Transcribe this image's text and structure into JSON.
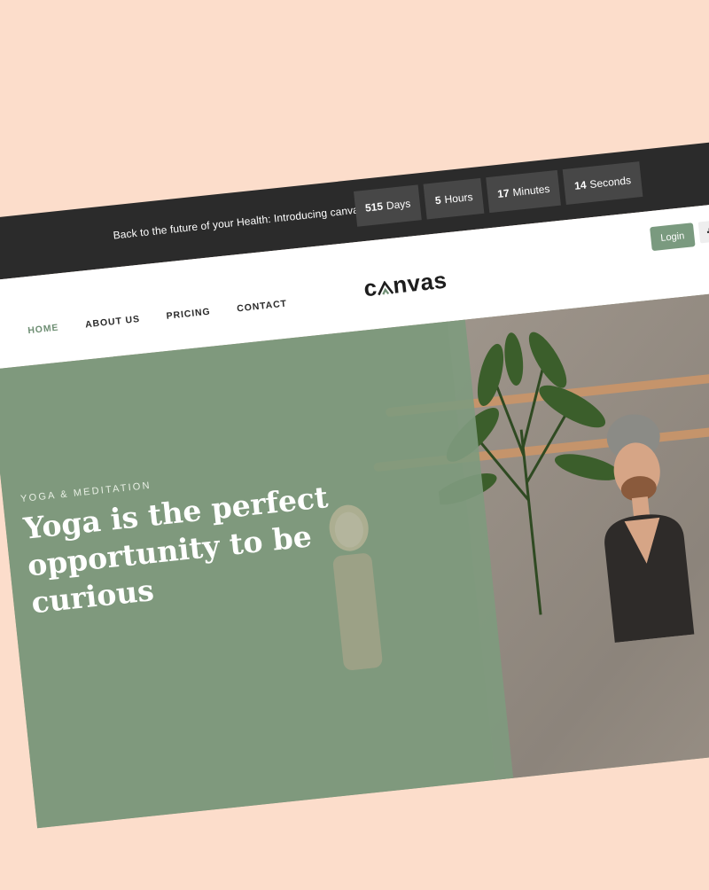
{
  "topbar": {
    "tagline": "Back to the future of your Health: Introducing canvas Yoga.",
    "countdown": [
      {
        "num": "515",
        "unit": "Days"
      },
      {
        "num": "5",
        "unit": "Hours"
      },
      {
        "num": "17",
        "unit": "Minutes"
      },
      {
        "num": "14",
        "unit": "Seconds"
      }
    ]
  },
  "nav": {
    "items": [
      "HOME",
      "ABOUT US",
      "PRICING",
      "CONTACT"
    ],
    "active": "HOME"
  },
  "logo": {
    "prefix": "c",
    "suffix": "nvas"
  },
  "header": {
    "login_label": "Login",
    "social": [
      "facebook-icon",
      "instagram-icon"
    ]
  },
  "hero": {
    "eyebrow": "YOGA & MEDITATION",
    "headline": "Yoga is the perfect opportunity to be curious"
  },
  "colors": {
    "accent": "#7a9a7f",
    "topbar": "#2b2b2b",
    "background": "#fcddcb"
  }
}
